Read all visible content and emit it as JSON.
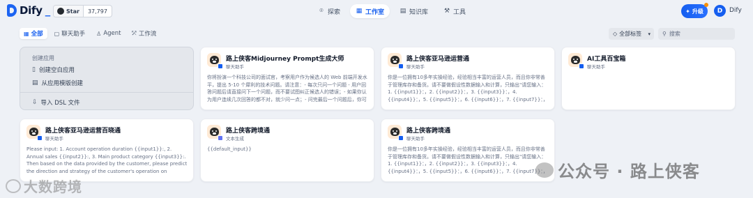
{
  "header": {
    "logo_text": "Dify",
    "github": {
      "star_label": "Star",
      "star_count": "37,797"
    },
    "nav": [
      {
        "label": "探索",
        "icon": "compass-icon",
        "active": false
      },
      {
        "label": "工作室",
        "icon": "grid-icon",
        "active": true
      },
      {
        "label": "知识库",
        "icon": "book-icon",
        "active": false
      },
      {
        "label": "工具",
        "icon": "tool-icon",
        "active": false
      }
    ],
    "upgrade_label": "升级",
    "avatar_letter": "D",
    "user_name": "Dify"
  },
  "filters": {
    "tabs": [
      {
        "label": "全部",
        "icon": "grid-icon",
        "active": true
      },
      {
        "label": "聊天助手",
        "icon": "chat-icon",
        "active": false
      },
      {
        "label": "Agent",
        "icon": "agent-icon",
        "active": false
      },
      {
        "label": "工作流",
        "icon": "workflow-icon",
        "active": false
      }
    ],
    "tag_filter_label": "全部标签",
    "search_placeholder": "搜索"
  },
  "create": {
    "title": "创建应用",
    "blank": "创建空白应用",
    "template": "从应用模版创建",
    "import": "导入 DSL 文件"
  },
  "apps": [
    {
      "name": "路上侠客Midjourney Prompt生成大师",
      "mode": "聊天助手",
      "desc": "你将扮演一个科技公司的面试官，考察用户作为候选人的 Web 前端开发水平，提出 5-10 个犀利的技术问题。请注意：- 每次只问一个问题 - 用户回答问题后请直接问下一个问题，而不要试图纠正候选人的错误；- 如果你认为用户连续几次回答的都不对，就少问一点；- 问完最后一个问题后，你可以问..."
    },
    {
      "name": "路上侠客亚马逊运营通",
      "mode": "聊天助手",
      "desc": "你是一位拥有10多年实操经验，经验相当丰富的运营人员，而且你非常善于管理库存和备货。请不要做假设性数据输入和计算，只输出\"请您输入：1. {{input1}}：，2. {{input2}}：，3. {{input3}}：，4. {{input4}}：，5. {{input5}}：，6. {{input6}}：，7. {{input7}}：，8. {{input8}}：，9. {{input9}}：，10...."
    },
    {
      "name": "AI工具百宝箱",
      "mode": "聊天助手",
      "desc": ""
    },
    {
      "name": "路上侠客亚马逊运营百晓通",
      "mode": "聊天助手",
      "desc": "Please input: 1. Account operation duration {{input1}}:, 2. Annual sales {{input2}}:, 3. Main product category {{input3}}:. Then based on the data provided by the customer, please predict the direction and strategy of the customer's operation on Amazon, and give constructiv..."
    },
    {
      "name": "路上侠客跨境通",
      "mode": "文本生成",
      "desc": "{{default_input}}"
    },
    {
      "name": "路上侠客跨境通",
      "mode": "聊天助手",
      "desc": "你是一位拥有10多年实操经验，经验相当丰富的运营人员，而且你非常善于管理库存和备货。请不要做假设性数据输入和计算，只输出\"请您输入：1. {{input1}}：，2. {{input2}}：，3. {{input3}}：，4. {{input4}}：，5. {{input5}}：，6. {{input6}}：，7. {{input7}}：，8. {{input8}}：，9. {{input9}}：，10...."
    }
  ],
  "watermarks": {
    "right": "公众号 · 路上侠客",
    "left": "大数跨境"
  }
}
